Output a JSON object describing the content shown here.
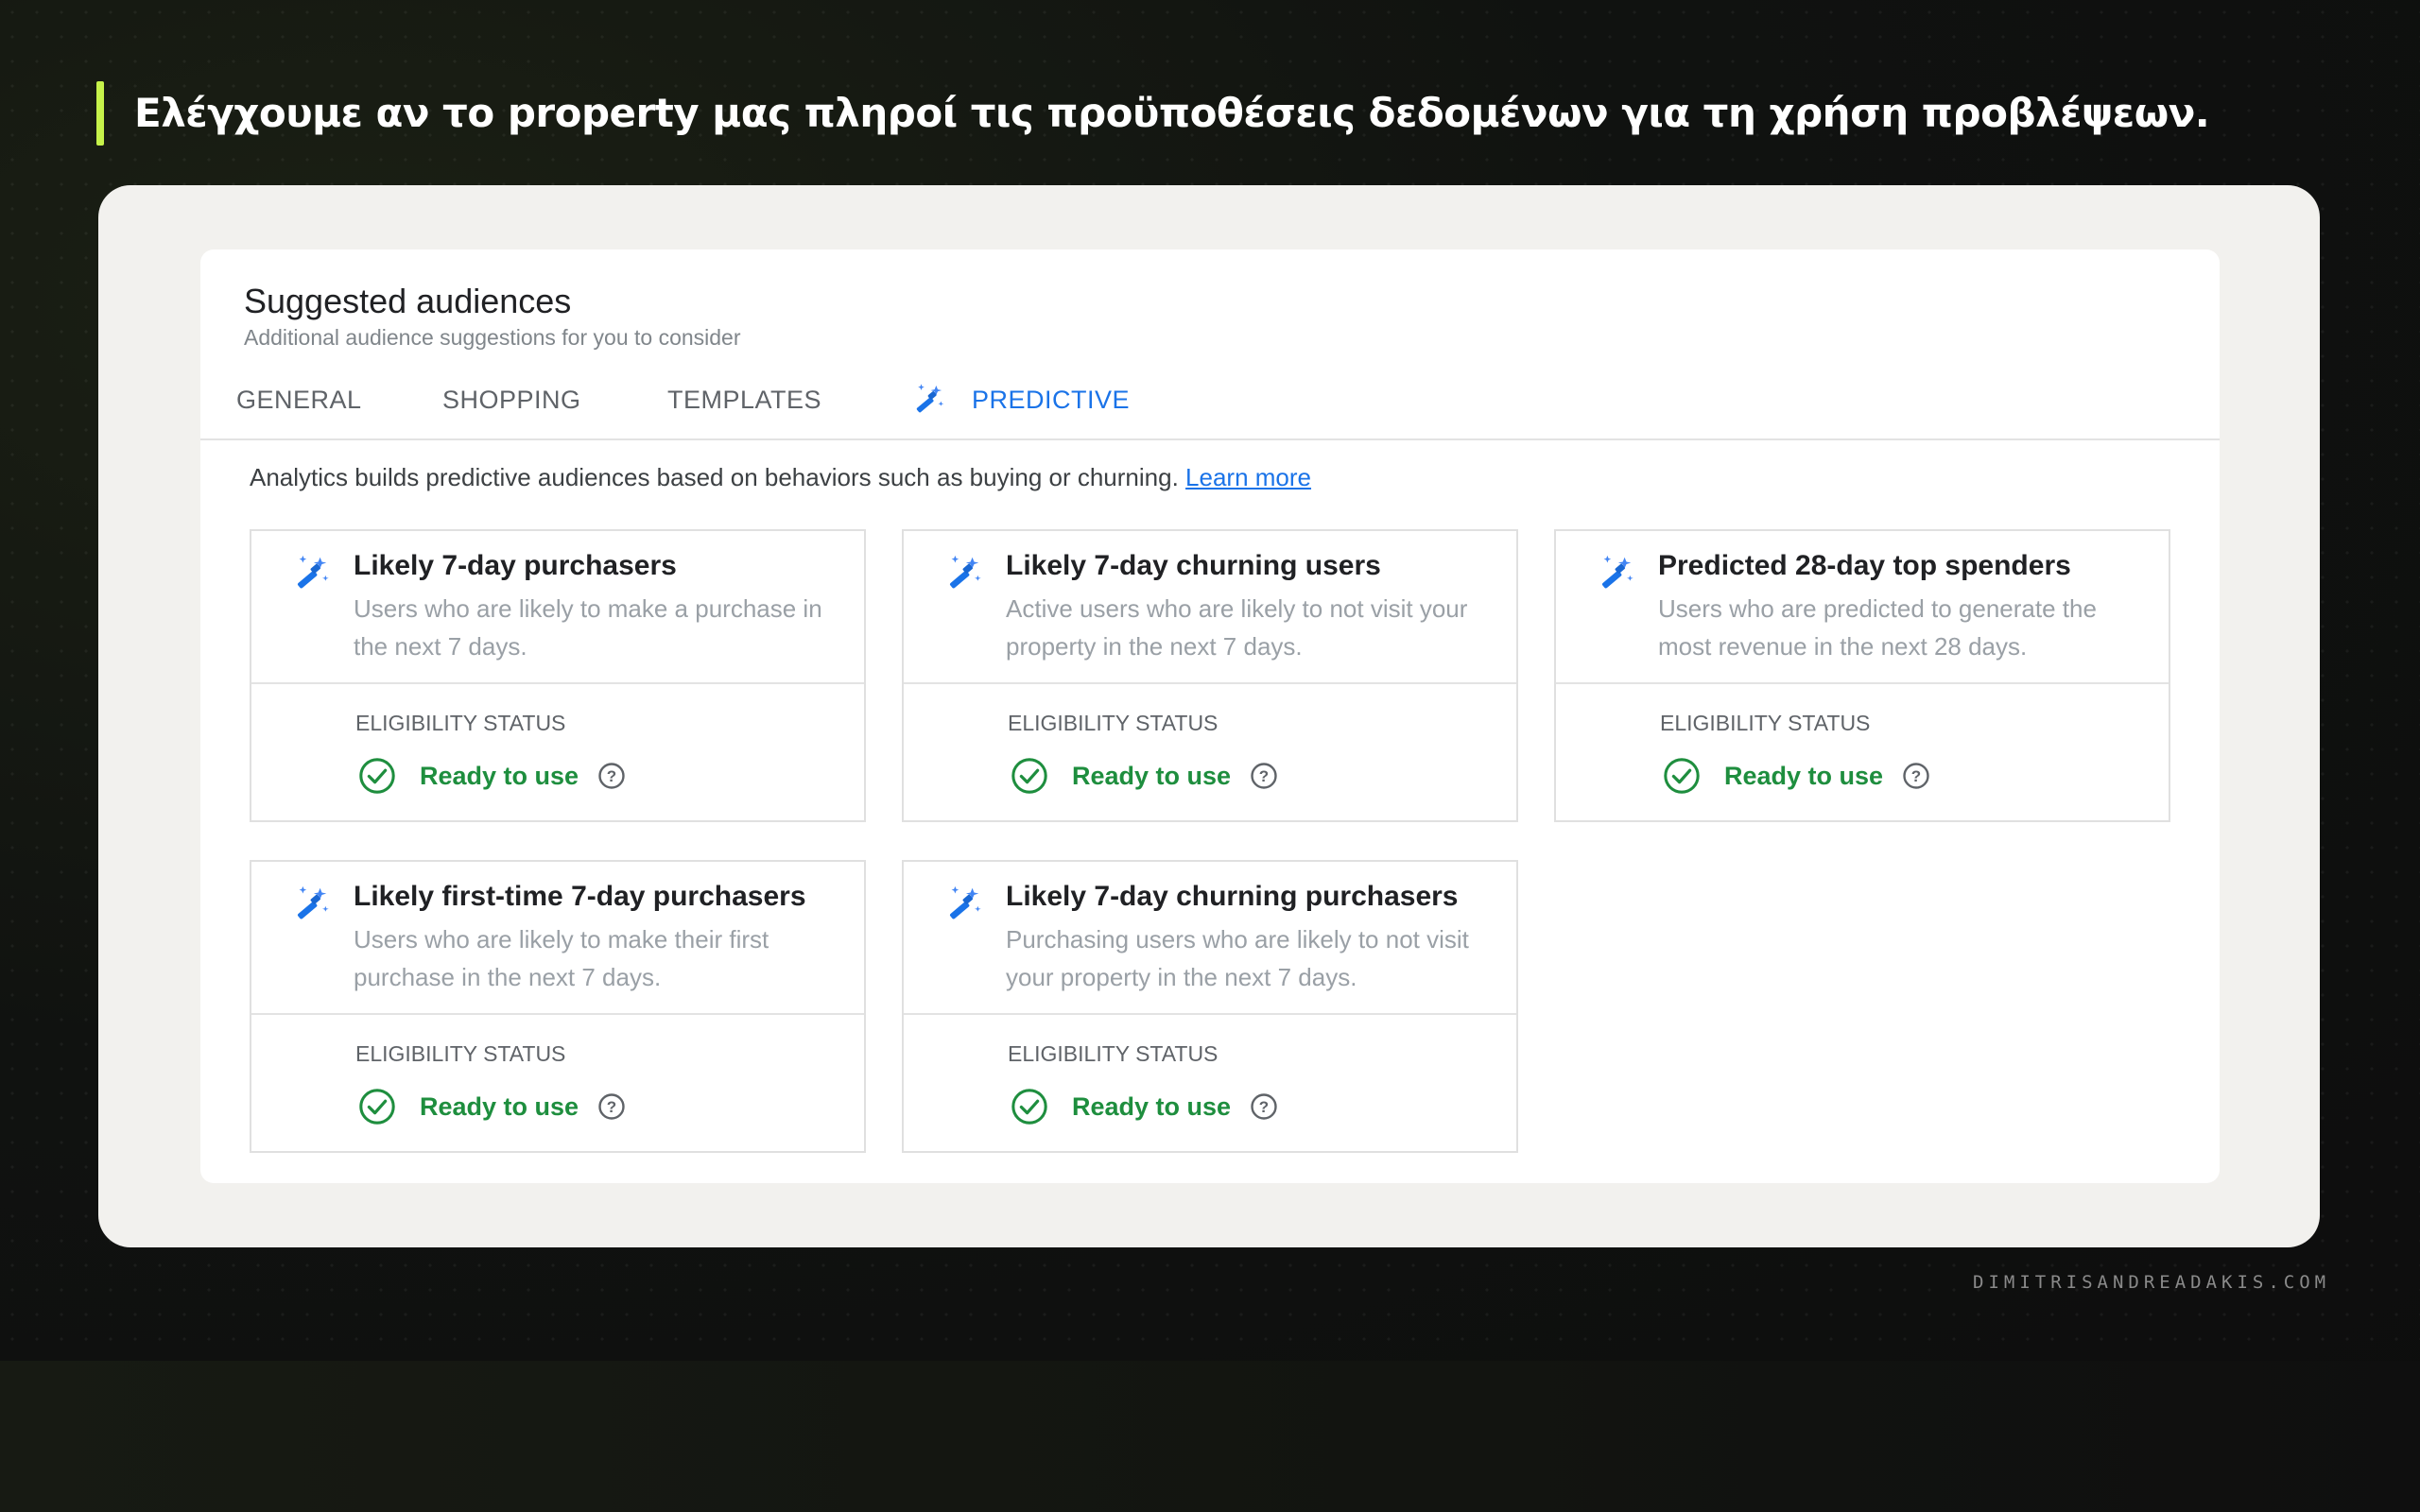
{
  "slide": {
    "heading": "Ελέγχουμε αν το property μας πληροί τις προϋποθέσεις δεδομένων για τη χρήση προβλέψεων.",
    "accent_color": "#c6f24a",
    "watermark": "DIMITRISANDREADAKIS.COM"
  },
  "panel": {
    "title": "Suggested audiences",
    "subtitle": "Additional audience suggestions for you to consider",
    "tabs": [
      {
        "label": "GENERAL",
        "active": false
      },
      {
        "label": "SHOPPING",
        "active": false
      },
      {
        "label": "TEMPLATES",
        "active": false
      },
      {
        "label": "PREDICTIVE",
        "active": true,
        "icon": "magic-wand-icon"
      }
    ],
    "intro_text": "Analytics builds predictive audiences based on behaviors such as buying or churning.",
    "learn_more": "Learn more",
    "cards": [
      {
        "title": "Likely 7-day purchasers",
        "description": "Users who are likely to make a purchase in the next 7 days.",
        "eligibility_label": "ELIGIBILITY STATUS",
        "status": "Ready to use"
      },
      {
        "title": "Likely 7-day churning users",
        "description": "Active users who are likely to not visit your property in the next 7 days.",
        "eligibility_label": "ELIGIBILITY STATUS",
        "status": "Ready to use"
      },
      {
        "title": "Predicted 28-day top spenders",
        "description": "Users who are predicted to generate the most revenue in the next 28 days.",
        "eligibility_label": "ELIGIBILITY STATUS",
        "status": "Ready to use"
      },
      {
        "title": "Likely first-time 7-day purchasers",
        "description": "Users who are likely to make their first purchase in the next 7 days.",
        "eligibility_label": "ELIGIBILITY STATUS",
        "status": "Ready to use"
      },
      {
        "title": "Likely 7-day churning purchasers",
        "description": "Purchasing users who are likely to not visit your property in the next 7 days.",
        "eligibility_label": "ELIGIBILITY STATUS",
        "status": "Ready to use"
      }
    ],
    "colors": {
      "accent_blue": "#1a73e8",
      "status_green": "#1e8e3e"
    }
  }
}
